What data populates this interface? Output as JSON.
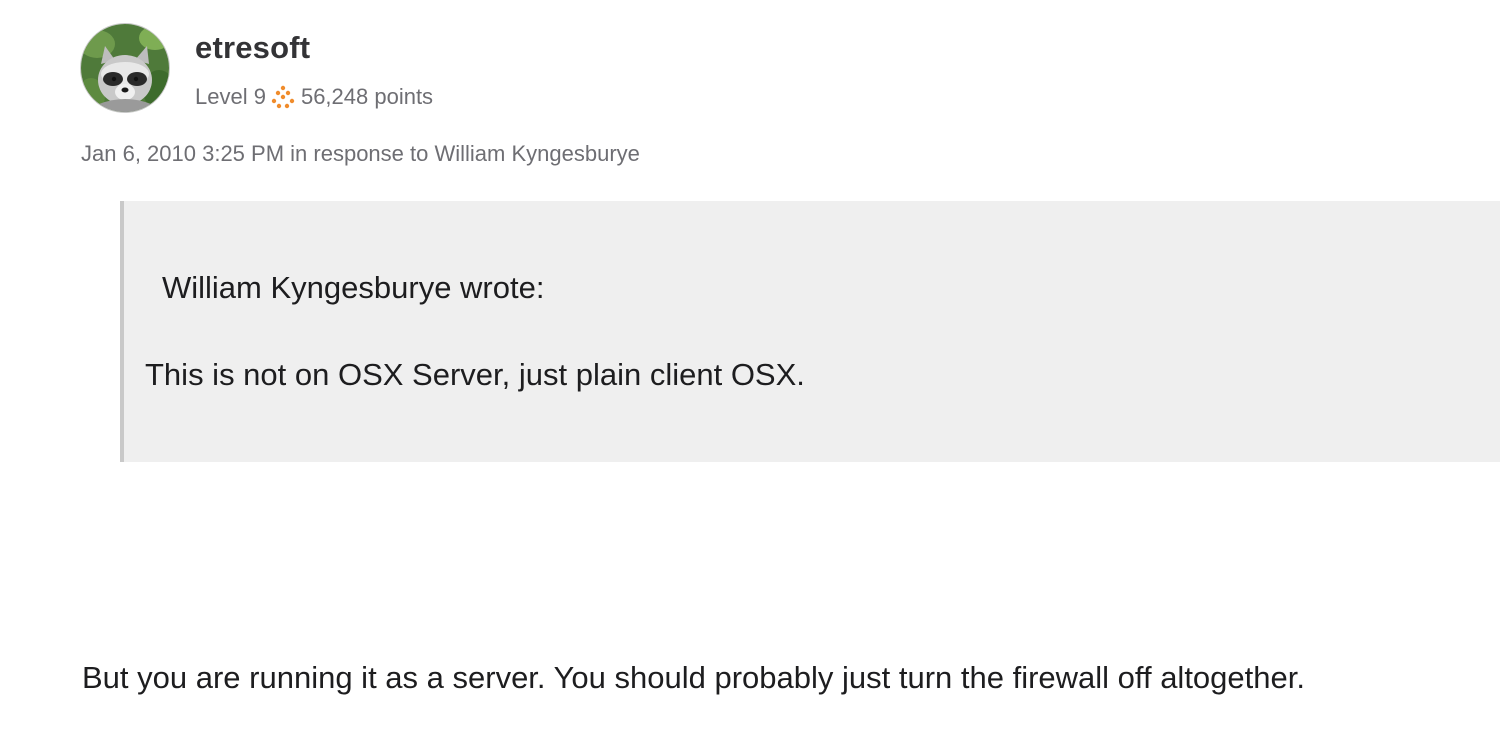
{
  "author": {
    "name": "etresoft",
    "level": "Level 9",
    "points": "56,248 points",
    "avatar_icon": "raccoon-avatar",
    "level_icon": "level-dots-icon",
    "level_color": "#f08c2c"
  },
  "post": {
    "date": "Jan 6, 2010 3:25 PM",
    "in_response_prefix": "in response to",
    "in_response_to": "William Kyngesburye"
  },
  "quote": {
    "header": "William Kyngesburye wrote:",
    "text": "This is not on OSX Server, just plain client OSX."
  },
  "reply": {
    "text": "But you are running it as a server. You should probably just turn the firewall off altogether."
  }
}
